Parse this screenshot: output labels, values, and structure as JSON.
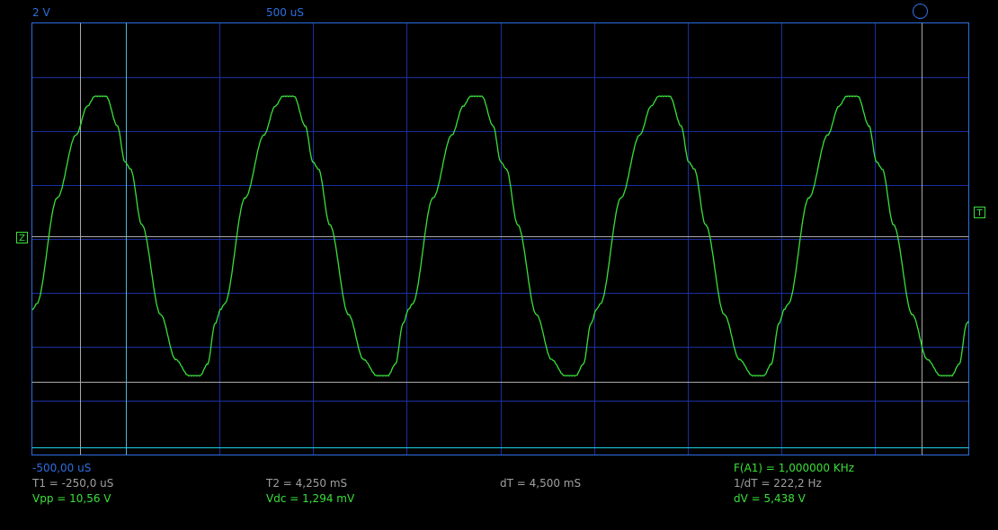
{
  "header": {
    "volts_per_div": "2 V",
    "time_per_div": "500 uS"
  },
  "markers": {
    "ground_marker": "Z",
    "trigger_marker": "T"
  },
  "scope": {
    "colors": {
      "background": "#000000",
      "grid": "#1a2fa0",
      "frame": "#2f6fe0",
      "trace": "#39e039",
      "cursor_grey": "#a8a8a8",
      "cursor_cyan": "#4fb8d0",
      "ref_line": "#1fd0e0"
    }
  },
  "readouts": {
    "time_offset": "-500,00 uS",
    "t1": "T1 = -250,0 uS",
    "t2": "T2 = 4,250 mS",
    "dt": "dT = 4,500 mS",
    "frequency": "F(A1) = 1,000000 KHz",
    "inv_dt": "1/dT = 222,2 Hz",
    "vpp": "Vpp = 10,56 V",
    "vdc": "Vdc = 1,294 mV",
    "dv": "dV = 5,438 V"
  }
}
